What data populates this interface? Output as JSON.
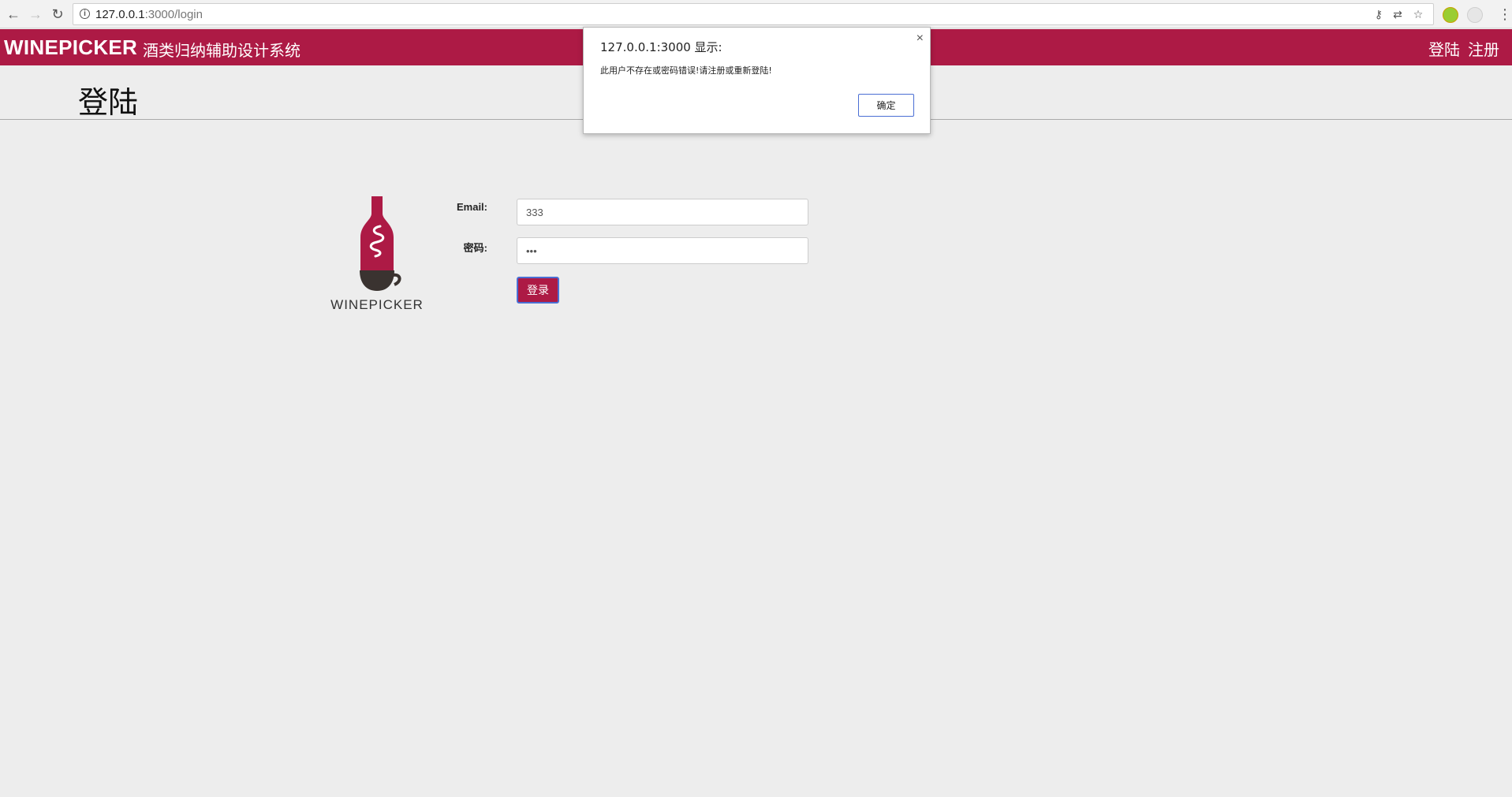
{
  "browser": {
    "url_host": "127.0.0.1",
    "url_path": ":3000/login"
  },
  "navbar": {
    "brand": "WINEPICKER",
    "subtitle": "酒类归纳辅助设计系统",
    "links": [
      "登陆",
      "注册"
    ],
    "color": "#ad1a45"
  },
  "page": {
    "title": "登陆"
  },
  "logo": {
    "text": "WINEPICKER"
  },
  "form": {
    "email_label": "Email:",
    "email_value": "333",
    "password_label": "密码:",
    "password_value": "•••",
    "submit_label": "登录"
  },
  "alert": {
    "title": "127.0.0.1:3000 显示:",
    "message": "此用户不存在或密码错误!请注册或重新登陆!",
    "ok_label": "确定",
    "close_icon": "×"
  },
  "icons": {
    "back": "←",
    "forward": "→",
    "reload": "↻",
    "info": "i",
    "key": "⚷",
    "translate": "⇄",
    "star": "☆",
    "menu": "⋮"
  }
}
